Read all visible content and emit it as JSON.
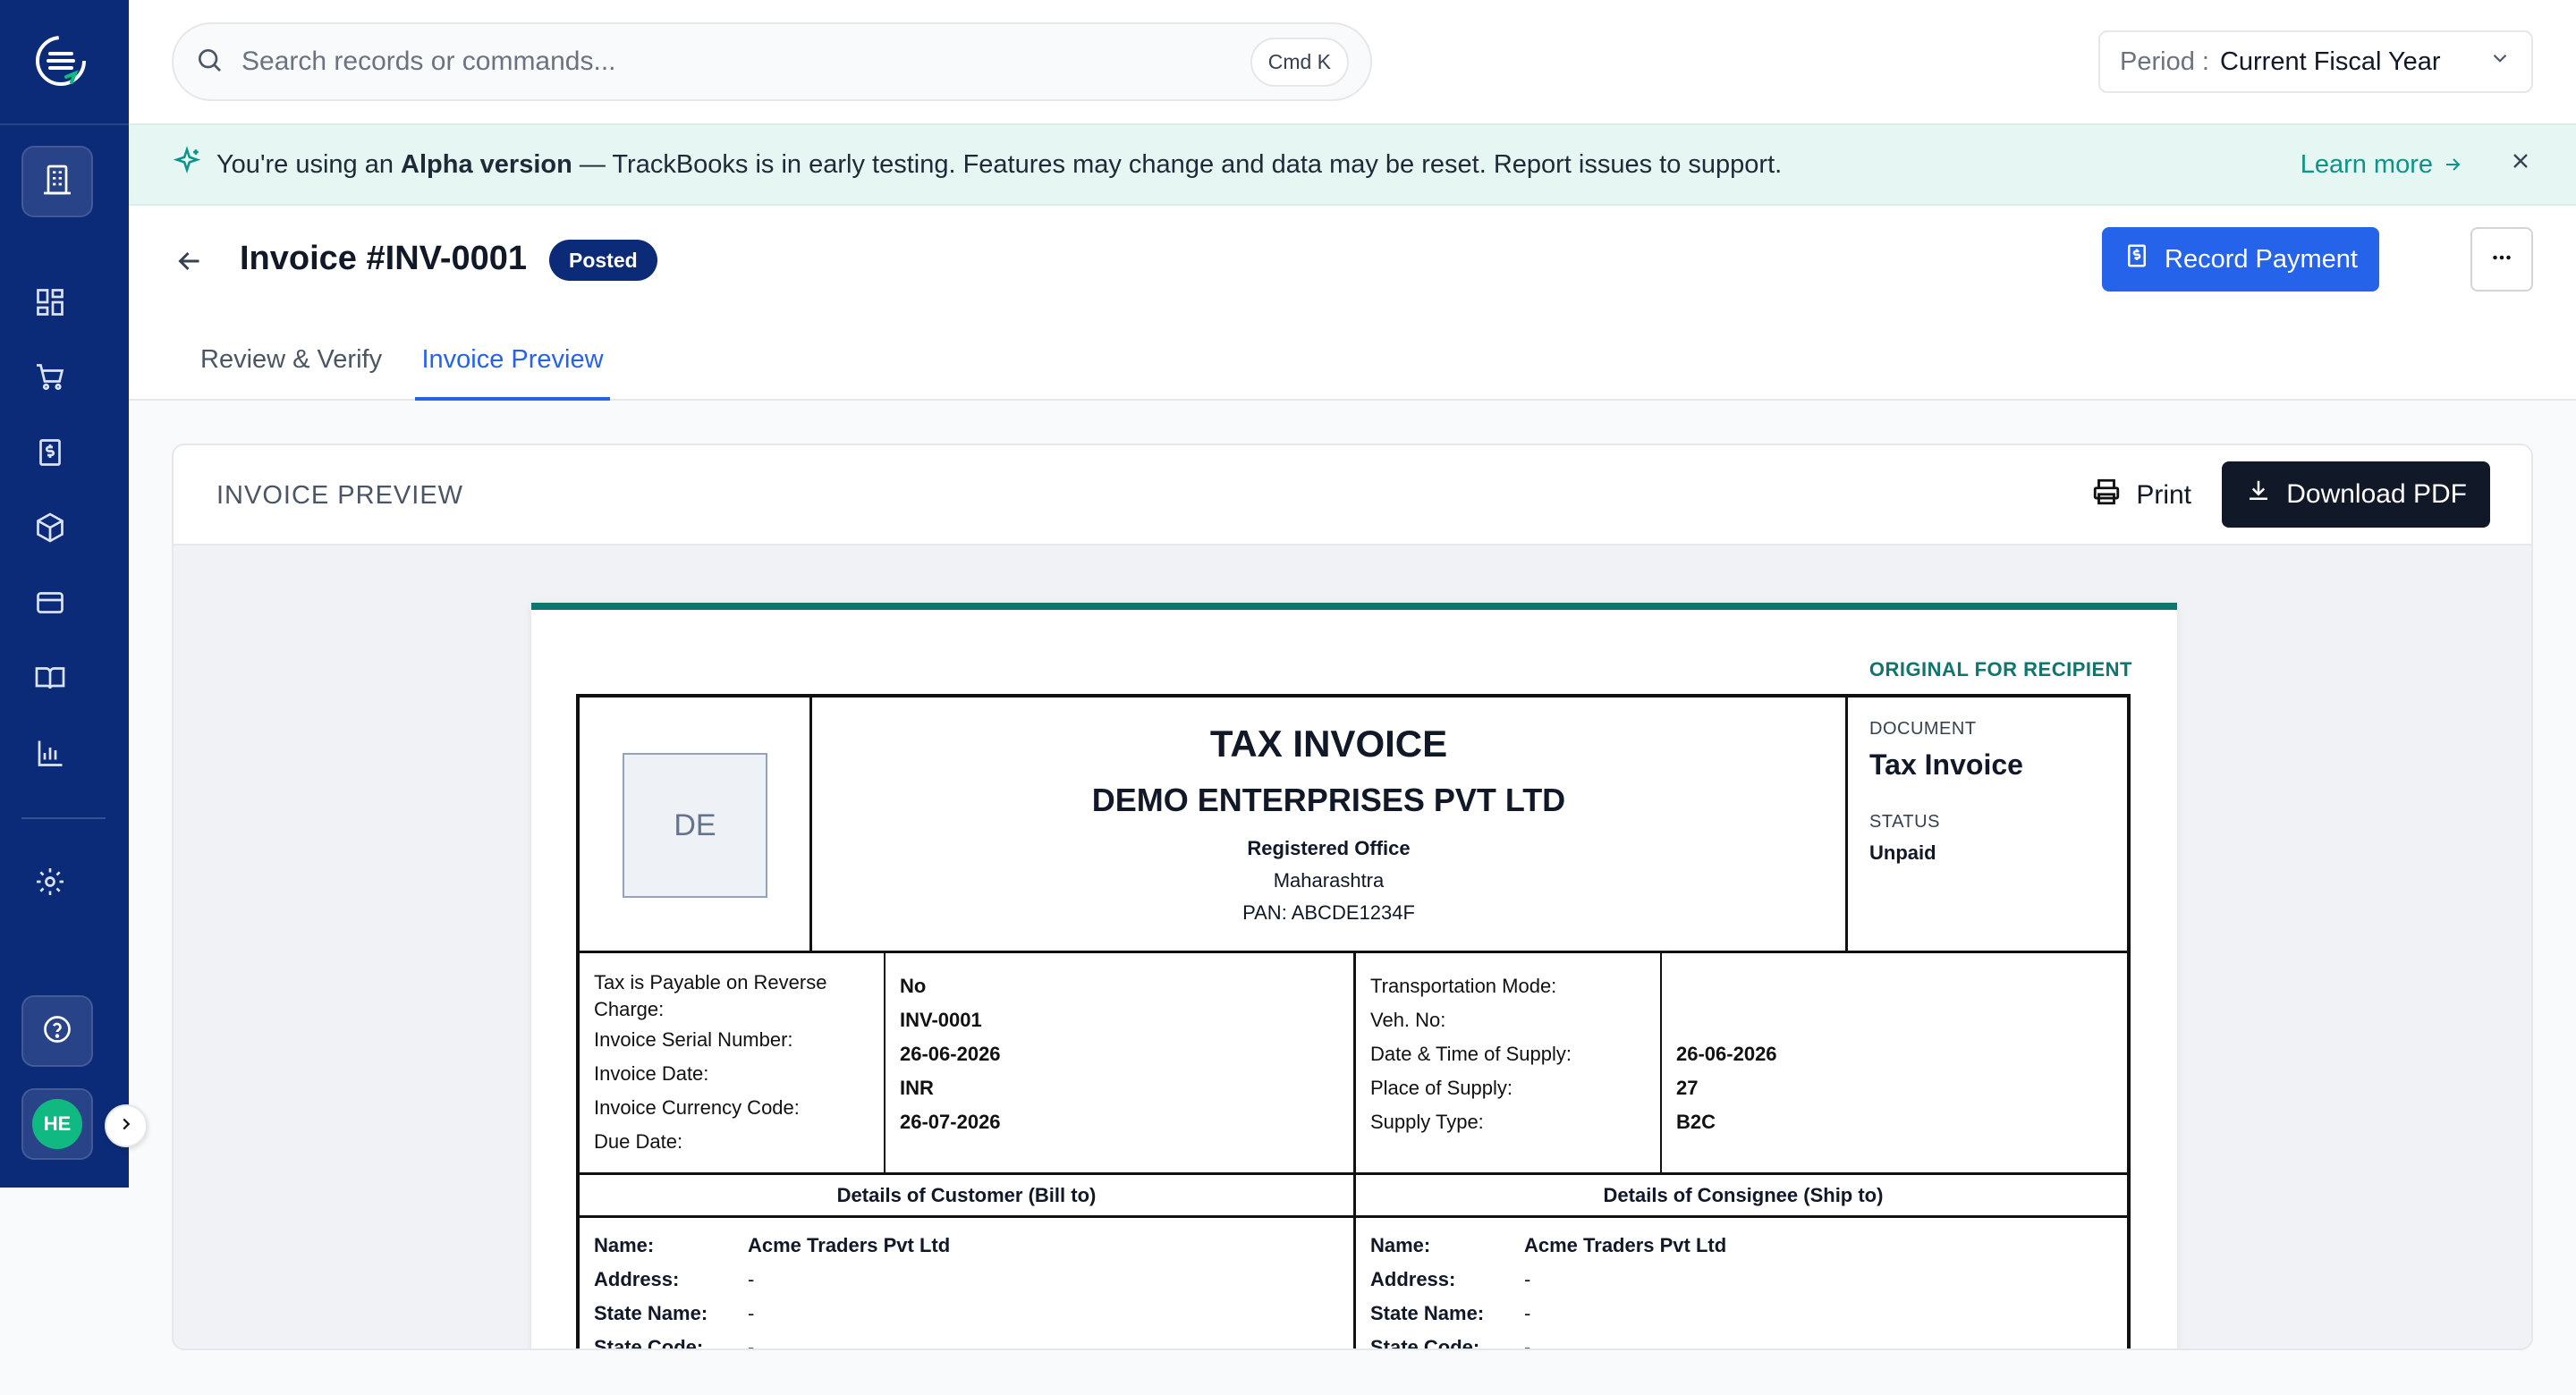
{
  "brand": {
    "colors": {
      "sidebar": "#0b2a78",
      "primary": "#2563eb",
      "accent": "#0f766e"
    }
  },
  "sidebar": {
    "logo_icon": "trackbooks-logo-icon",
    "items": [
      {
        "icon": "building-icon",
        "active": true
      },
      {
        "icon": "dashboard-grid-icon"
      },
      {
        "icon": "shopping-cart-icon"
      },
      {
        "icon": "invoice-dollar-icon"
      },
      {
        "icon": "package-box-icon"
      },
      {
        "icon": "credit-card-icon"
      },
      {
        "icon": "book-open-icon"
      },
      {
        "icon": "bar-chart-icon"
      },
      {
        "icon": "settings-gear-icon"
      }
    ],
    "help_icon": "help-circle-icon",
    "user_initials": "HE"
  },
  "topbar": {
    "search_placeholder": "Search records or commands...",
    "search_shortcut": "Cmd K",
    "period_label": "Period :",
    "period_value": "Current Fiscal Year"
  },
  "banner": {
    "prefix": "You're using an",
    "highlight": "Alpha version",
    "message": "— TrackBooks is in early testing. Features may change and data may be reset. Report issues to support.",
    "learn_more": "Learn more"
  },
  "header": {
    "title": "Invoice #INV-0001",
    "status_badge": "Posted",
    "record_payment": "Record Payment",
    "tabs": [
      {
        "label": "Review & Verify",
        "active": false
      },
      {
        "label": "Invoice Preview",
        "active": true
      }
    ]
  },
  "preview": {
    "title": "INVOICE PREVIEW",
    "print": "Print",
    "download": "Download PDF"
  },
  "invoice": {
    "copy_label": "ORIGINAL FOR RECIPIENT",
    "logo_initials": "DE",
    "doc_title": "TAX INVOICE",
    "company": "DEMO ENTERPRISES PVT LTD",
    "registered_office_label": "Registered Office",
    "state": "Maharashtra",
    "pan": "PAN: ABCDE1234F",
    "document_label": "DOCUMENT",
    "document_value": "Tax Invoice",
    "status_label": "STATUS",
    "status_value": "Unpaid",
    "meta_left": {
      "labels": [
        "Tax is Payable on Reverse Charge:",
        "Invoice Serial Number:",
        "Invoice Date:",
        "Invoice Currency Code:",
        "Due Date:"
      ],
      "values": [
        "No",
        "INV-0001",
        "26-06-2026",
        "INR",
        "26-07-2026"
      ]
    },
    "meta_right": {
      "labels": [
        "Transportation Mode:",
        "Veh. No:",
        "Date & Time of Supply:",
        "Place of Supply:",
        "Supply Type:"
      ],
      "values": [
        "",
        "",
        "26-06-2026",
        "27",
        "B2C"
      ]
    },
    "customer_heading": "Details of Customer (Bill to)",
    "consignee_heading": "Details of Consignee (Ship to)",
    "party_labels": [
      "Name:",
      "Address:",
      "State Name:",
      "State Code:"
    ],
    "customer_values": [
      "Acme Traders Pvt Ltd",
      "-",
      "-",
      "-"
    ],
    "consignee_values": [
      "Acme Traders Pvt Ltd",
      "-",
      "-",
      "-"
    ]
  }
}
